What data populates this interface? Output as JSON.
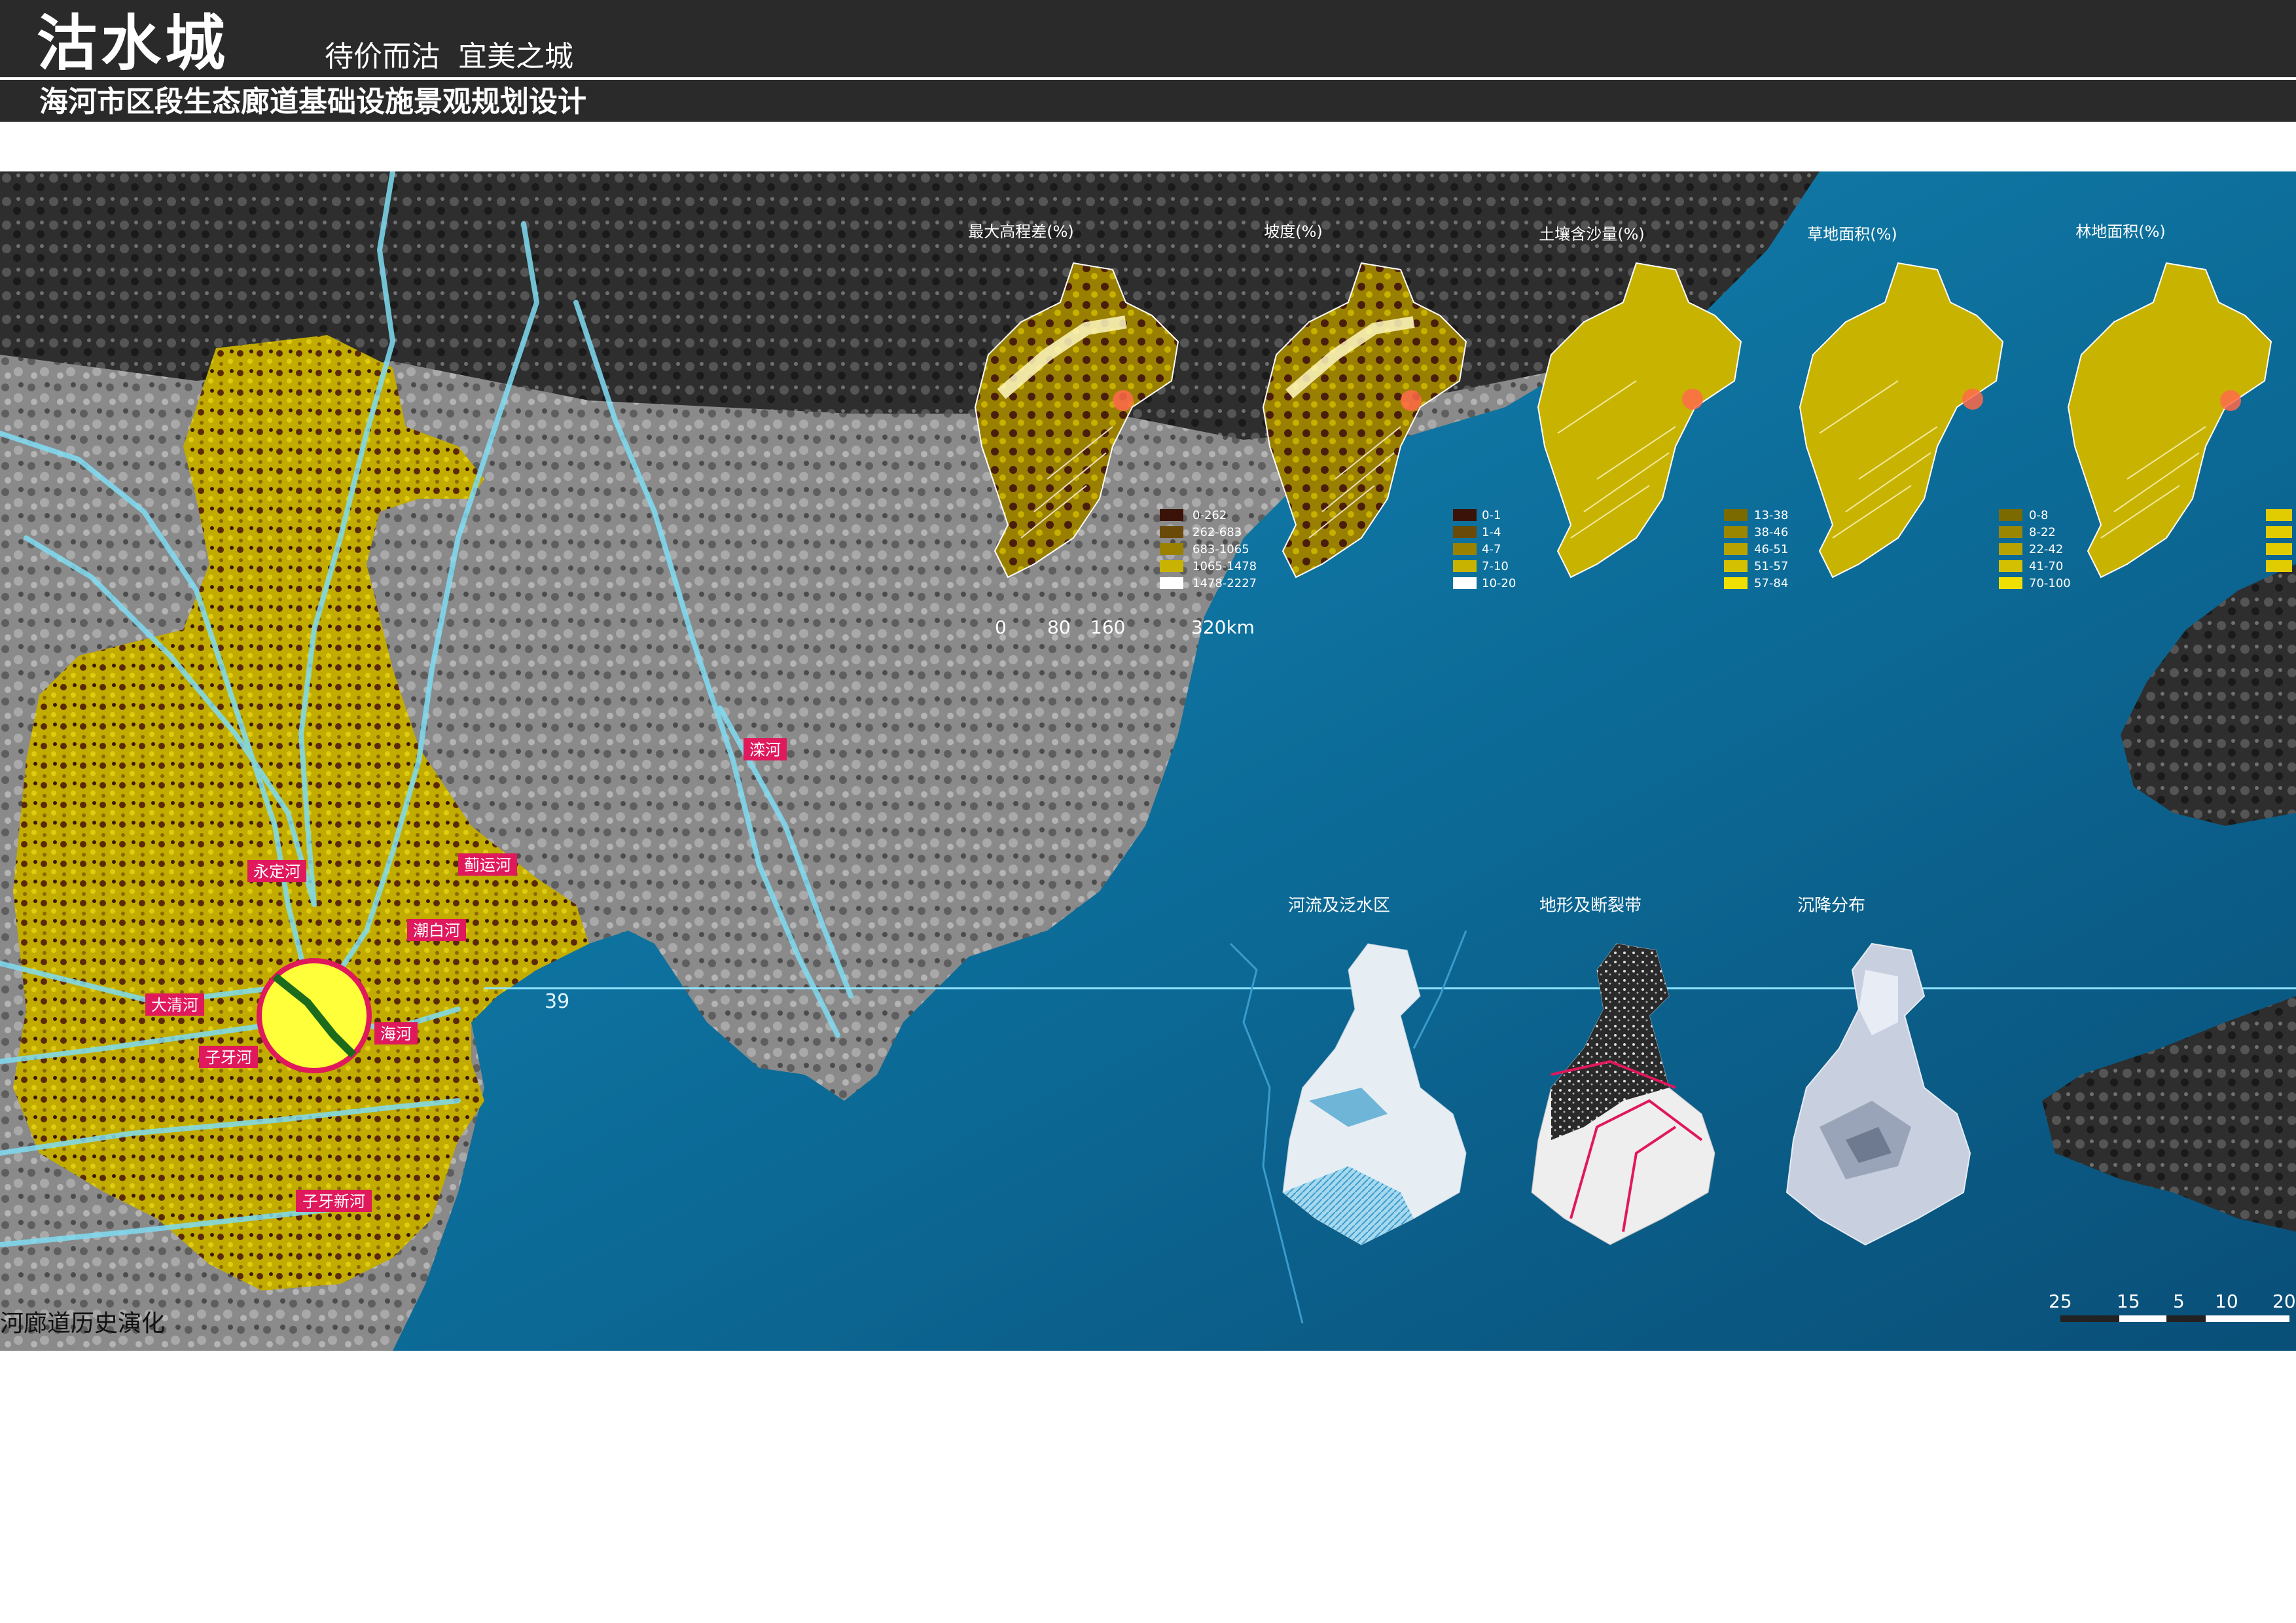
{
  "header": {
    "brand_title": "沽水城",
    "slogan": "待价而沽  宜美之城",
    "project_title": "海河市区段生态廊道基础设施景观规划设计"
  },
  "colors": {
    "sea": "#0d6f9c",
    "land": "#7a7a7a",
    "yellow": "#c8b400",
    "river": "#7fdcf2",
    "label_bg": "#e0185c",
    "highlight": "#ffff3a",
    "section_line": "#8fe4ff"
  },
  "main_map": {
    "river_labels": [
      "永定河",
      "蓟运河",
      "潮白河",
      "大清河",
      "海河",
      "子牙河",
      "子牙新河",
      "滦河"
    ],
    "latitude_label": "39",
    "bottom_caption": "河廊道历史演化",
    "scale_bar_labels": [
      "25",
      "15",
      "5",
      "10",
      "20"
    ]
  },
  "top_maps": [
    {
      "title": "最大高程差(%)",
      "legend": [
        "0-262",
        "262-683",
        "683-1065",
        "1065-1478",
        "1478-2227"
      ]
    },
    {
      "title": "坡度(%)",
      "legend": [
        "0-1",
        "1-4",
        "4-7",
        "7-10",
        "10-20"
      ]
    },
    {
      "title": "土壤含沙量(%)",
      "legend": [
        "13-38",
        "38-46",
        "46-51",
        "51-57",
        "57-84"
      ]
    },
    {
      "title": "草地面积(%)",
      "legend": [
        "0-8",
        "8-22",
        "22-42",
        "41-70",
        "70-100"
      ]
    },
    {
      "title": "林地面积(%)",
      "legend": []
    }
  ],
  "top_scale_labels": [
    "0",
    "80",
    "160",
    "320km"
  ],
  "bottom_maps": [
    {
      "title": "河流及泛水区"
    },
    {
      "title": "地形及断裂带"
    },
    {
      "title": "沉降分布"
    }
  ]
}
